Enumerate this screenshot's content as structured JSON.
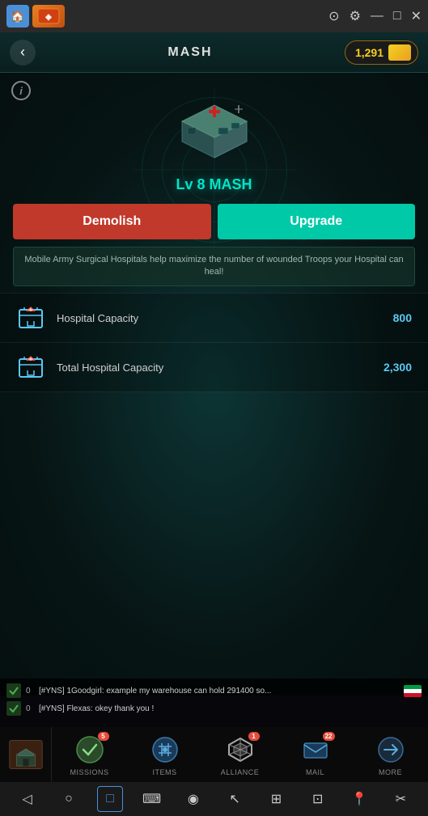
{
  "titlebar": {
    "app_icon": "🏠",
    "controls": [
      "⊙",
      "⚙",
      "—",
      "□",
      "✕"
    ]
  },
  "header": {
    "title": "MASH",
    "back_icon": "‹",
    "gold": "1,291"
  },
  "building": {
    "name": "Lv 8 MASH",
    "description": "Mobile Army Surgical Hospitals help maximize the number of wounded Troops your Hospital can heal!",
    "demolish_label": "Demolish",
    "upgrade_label": "Upgrade"
  },
  "stats": [
    {
      "label": "Hospital Capacity",
      "value": "800"
    },
    {
      "label": "Total Hospital Capacity",
      "value": "2,300"
    }
  ],
  "chat": [
    {
      "prefix": "0",
      "text": "[#YNS] 1Goodgirl: example my warehouse can hold 291400 so..."
    },
    {
      "prefix": "0",
      "text": "[#YNS] Flexas: okey thank you !"
    }
  ],
  "nav": [
    {
      "label": "",
      "badge": null,
      "icon_type": "building"
    },
    {
      "label": "MISSIONS",
      "badge": "5",
      "icon_type": "missions"
    },
    {
      "label": "ITEMS",
      "badge": null,
      "icon_type": "items"
    },
    {
      "label": "ALLIANCE",
      "badge": "1",
      "icon_type": "alliance"
    },
    {
      "label": "MAIL",
      "badge": "22",
      "icon_type": "mail"
    },
    {
      "label": "MORE",
      "badge": null,
      "icon_type": "more"
    }
  ],
  "sysbar": {
    "buttons": [
      "◁",
      "○",
      "□",
      "⌨",
      "◉",
      "↖",
      "⊞",
      "⊡",
      "📍",
      "✂"
    ]
  }
}
